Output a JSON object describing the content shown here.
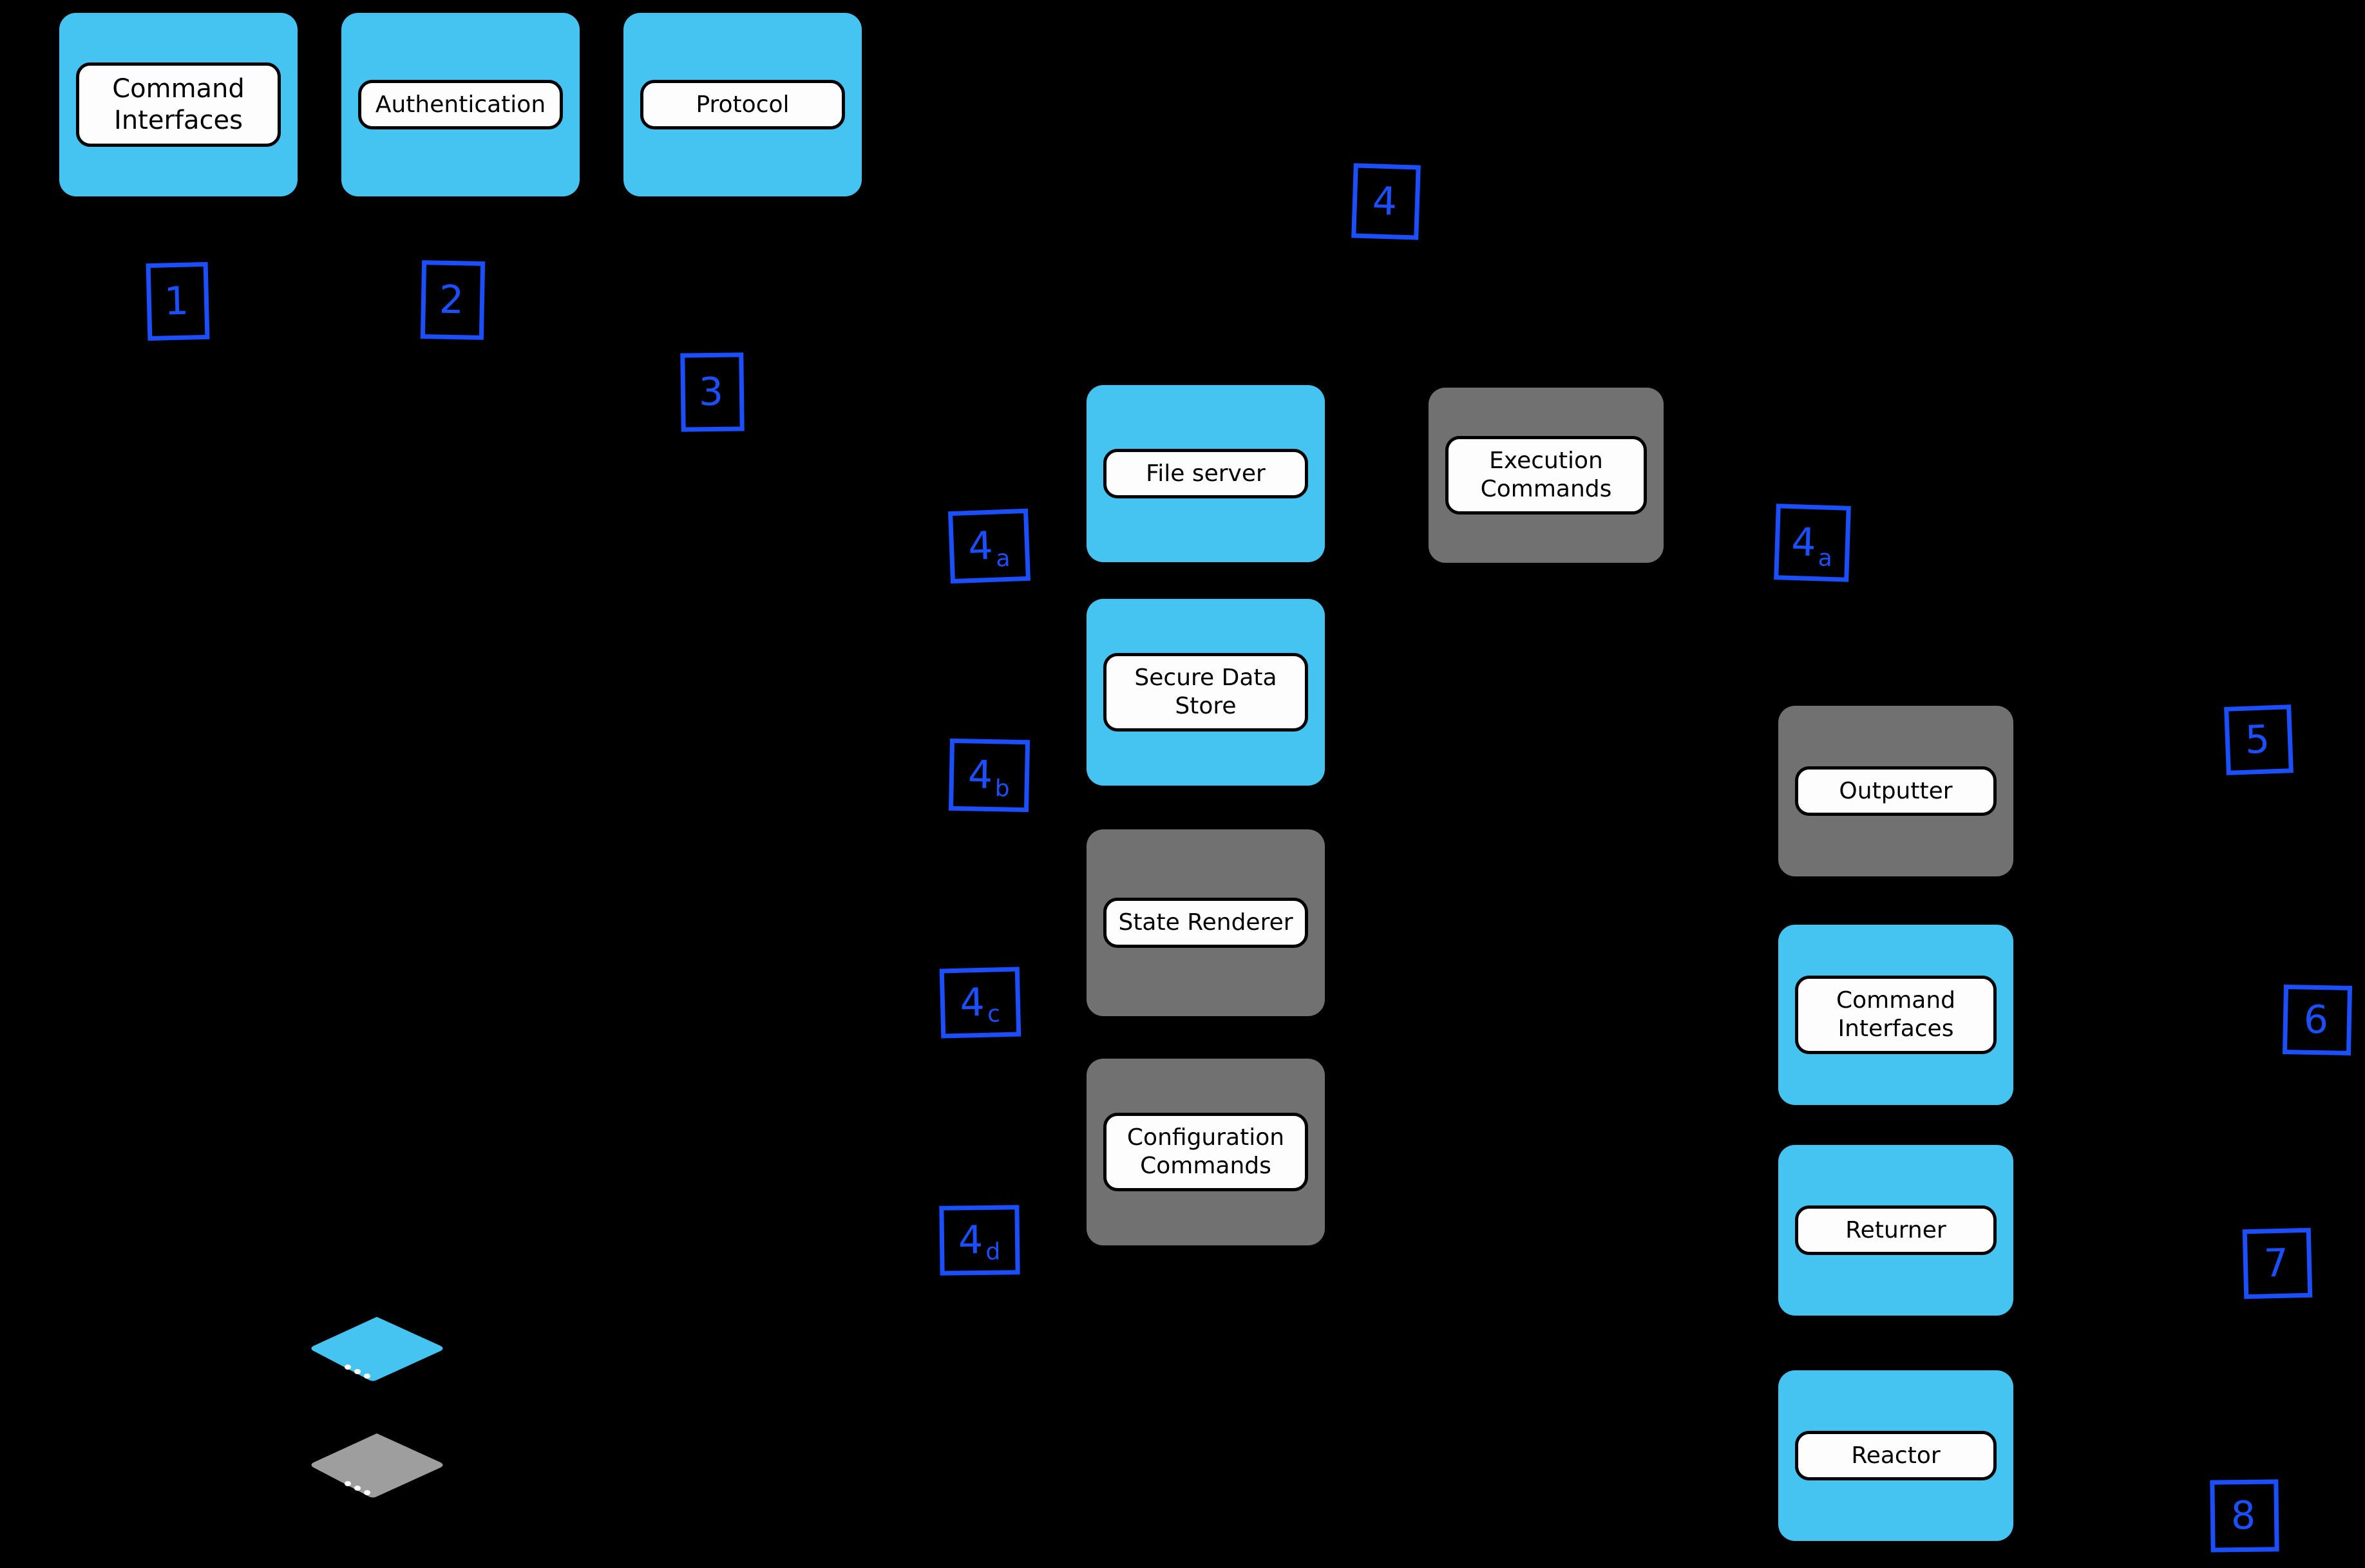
{
  "diagram": {
    "background_color": "#000000",
    "node_blue_color": "#45c4f2",
    "node_gray_color": "#717171",
    "marker_color": "#1a4ffb",
    "pill_fill_color": "#fdfdfd"
  },
  "nodes": {
    "top_row": [
      {
        "label": "Command\nInterfaces",
        "color": "blue"
      },
      {
        "label": "Authentication",
        "color": "blue"
      },
      {
        "label": "Protocol",
        "color": "blue"
      }
    ],
    "middle_column": [
      {
        "label": "File server",
        "color": "blue"
      },
      {
        "label": "Secure Data\nStore",
        "color": "blue"
      },
      {
        "label": "State Renderer",
        "color": "gray"
      },
      {
        "label": "Configuration\nCommands",
        "color": "gray"
      }
    ],
    "center_column": [
      {
        "label": "Execution\nCommands",
        "color": "gray"
      }
    ],
    "right_column": [
      {
        "label": "Outputter",
        "color": "gray"
      },
      {
        "label": "Command\nInterfaces",
        "color": "blue"
      },
      {
        "label": "Returner",
        "color": "blue"
      },
      {
        "label": "Reactor",
        "color": "blue"
      }
    ]
  },
  "markers": [
    {
      "id": "m1",
      "main": "1",
      "sub": ""
    },
    {
      "id": "m2",
      "main": "2",
      "sub": ""
    },
    {
      "id": "m3",
      "main": "3",
      "sub": ""
    },
    {
      "id": "m4",
      "main": "4",
      "sub": ""
    },
    {
      "id": "m4a_left",
      "main": "4",
      "sub": "a"
    },
    {
      "id": "m4b",
      "main": "4",
      "sub": "b"
    },
    {
      "id": "m4c",
      "main": "4",
      "sub": "c"
    },
    {
      "id": "m4d",
      "main": "4",
      "sub": "d"
    },
    {
      "id": "m4a_right",
      "main": "4",
      "sub": "a"
    },
    {
      "id": "m5",
      "main": "5",
      "sub": ""
    },
    {
      "id": "m6",
      "main": "6",
      "sub": ""
    },
    {
      "id": "m7",
      "main": "7",
      "sub": ""
    },
    {
      "id": "m8",
      "main": "8",
      "sub": ""
    }
  ],
  "legend_shapes": [
    {
      "name": "isometric-disk-blue",
      "color": "#45c4f2",
      "dots": 3
    },
    {
      "name": "isometric-disk-gray",
      "color": "#9e9e9e",
      "dots": 3
    }
  ]
}
